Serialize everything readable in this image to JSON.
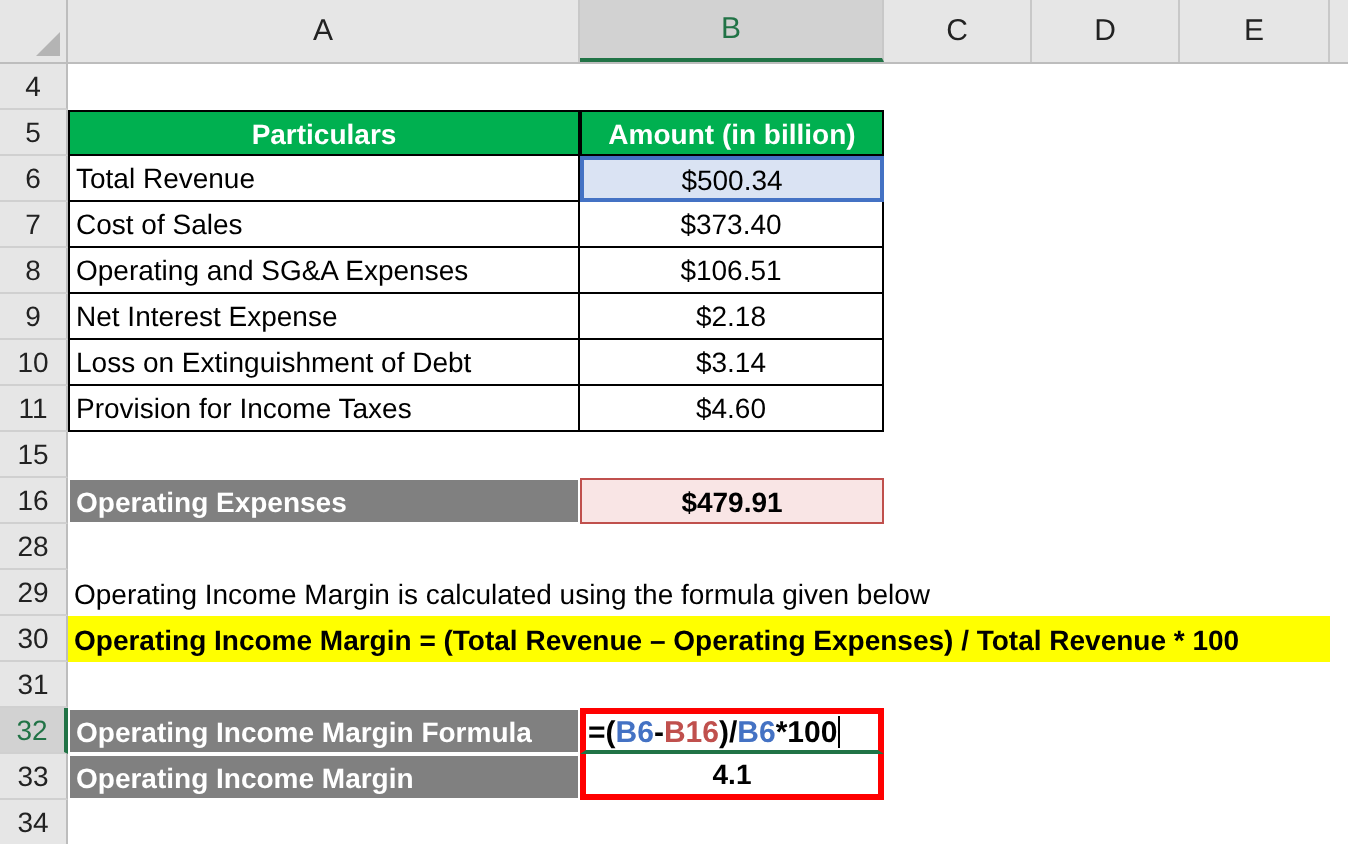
{
  "column_headers": [
    {
      "label": "A",
      "selected": false
    },
    {
      "label": "B",
      "selected": true
    },
    {
      "label": "C",
      "selected": false
    },
    {
      "label": "D",
      "selected": false
    },
    {
      "label": "E",
      "selected": false
    }
  ],
  "rows": [
    {
      "number": "4",
      "selected": false,
      "cells": []
    },
    {
      "number": "5",
      "selected": false,
      "cells": [
        {
          "kind": "head",
          "text": "Particulars"
        },
        {
          "kind": "head",
          "text": "Amount (in billion)"
        }
      ]
    },
    {
      "number": "6",
      "selected": false,
      "cells": [
        {
          "kind": "label",
          "text": "Total Revenue"
        },
        {
          "kind": "value",
          "text": "$500.34",
          "selected": true
        }
      ]
    },
    {
      "number": "7",
      "selected": false,
      "cells": [
        {
          "kind": "label",
          "text": "Cost of Sales"
        },
        {
          "kind": "value",
          "text": "$373.40",
          "selected": false
        }
      ]
    },
    {
      "number": "8",
      "selected": false,
      "cells": [
        {
          "kind": "label",
          "text": "Operating and SG&A Expenses"
        },
        {
          "kind": "value",
          "text": "$106.51",
          "selected": false
        }
      ]
    },
    {
      "number": "9",
      "selected": false,
      "cells": [
        {
          "kind": "label",
          "text": "Net Interest Expense"
        },
        {
          "kind": "value",
          "text": "$2.18",
          "selected": false
        }
      ]
    },
    {
      "number": "10",
      "selected": false,
      "cells": [
        {
          "kind": "label",
          "text": "Loss on Extinguishment of Debt"
        },
        {
          "kind": "value",
          "text": "$3.14",
          "selected": false
        }
      ]
    },
    {
      "number": "11",
      "selected": false,
      "cells": [
        {
          "kind": "label",
          "text": "Provision for Income Taxes"
        },
        {
          "kind": "value",
          "text": "$4.60",
          "selected": false
        }
      ]
    },
    {
      "number": "15",
      "selected": false,
      "cells": []
    },
    {
      "number": "16",
      "selected": false,
      "cells": [
        {
          "kind": "dark-label",
          "text": "Operating Expenses"
        },
        {
          "kind": "reference",
          "text": "$479.91"
        }
      ]
    },
    {
      "number": "28",
      "selected": false,
      "cells": []
    },
    {
      "number": "29",
      "selected": false,
      "cells": [
        {
          "kind": "note",
          "text": "Operating Income Margin is calculated using the formula given below"
        }
      ]
    },
    {
      "number": "30",
      "selected": false,
      "cells": [
        {
          "kind": "highlight",
          "text": "Operating Income Margin = (Total Revenue – Operating Expenses) / Total Revenue * 100"
        }
      ]
    },
    {
      "number": "31",
      "selected": false,
      "cells": []
    },
    {
      "number": "32",
      "selected": true,
      "cells": [
        {
          "kind": "dark-label",
          "text": "Operating Income Margin Formula"
        },
        {
          "kind": "formula",
          "outlined": true,
          "tokens": [
            {
              "text": "=(",
              "color": "#000000"
            },
            {
              "text": "B6",
              "color": "#4472c4"
            },
            {
              "text": "-",
              "color": "#000000"
            },
            {
              "text": "B16",
              "color": "#c0504d"
            },
            {
              "text": ")/",
              "color": "#000000"
            },
            {
              "text": "B6",
              "color": "#4472c4"
            },
            {
              "text": "*100",
              "color": "#000000"
            }
          ]
        }
      ]
    },
    {
      "number": "33",
      "selected": false,
      "cells": [
        {
          "kind": "dark-label",
          "text": "Operating Income Margin"
        },
        {
          "kind": "result",
          "text": "4.1",
          "outlined": true
        }
      ]
    },
    {
      "number": "34",
      "selected": false,
      "cells": []
    }
  ]
}
